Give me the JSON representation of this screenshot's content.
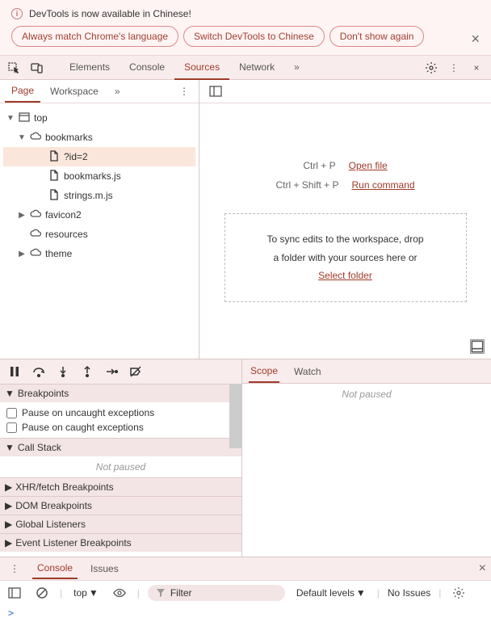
{
  "banner": {
    "title": "DevTools is now available in Chinese!",
    "buttons": [
      "Always match Chrome's language",
      "Switch DevTools to Chinese",
      "Don't show again"
    ]
  },
  "toolbar": {
    "tabs": [
      "Elements",
      "Console",
      "Sources",
      "Network"
    ],
    "active": "Sources"
  },
  "sidebar": {
    "tabs": [
      "Page",
      "Workspace"
    ],
    "active": "Page",
    "tree": {
      "top": "top",
      "bookmarks": "bookmarks",
      "files": [
        "?id=2",
        "bookmarks.js",
        "strings.m.js"
      ],
      "folders": [
        "favicon2",
        "resources",
        "theme"
      ]
    }
  },
  "editor": {
    "openFileKey": "Ctrl + P",
    "openFileLabel": "Open file",
    "runCmdKey": "Ctrl + Shift + P",
    "runCmdLabel": "Run command",
    "dropLine1": "To sync edits to the workspace, drop",
    "dropLine2": "a folder with your sources here or",
    "selectFolder": "Select folder"
  },
  "debug": {
    "sections": {
      "breakpoints": "Breakpoints",
      "pauseUncaught": "Pause on uncaught exceptions",
      "pauseCaught": "Pause on caught exceptions",
      "callStack": "Call Stack",
      "notPaused": "Not paused",
      "xhr": "XHR/fetch Breakpoints",
      "dom": "DOM Breakpoints",
      "global": "Global Listeners",
      "event": "Event Listener Breakpoints"
    },
    "scopeTabs": [
      "Scope",
      "Watch"
    ],
    "scopeNotPaused": "Not paused"
  },
  "drawer": {
    "tabs": [
      "Console",
      "Issues"
    ],
    "context": "top",
    "filterPlaceholder": "Filter",
    "levels": "Default levels",
    "issues": "No Issues",
    "prompt": ">"
  }
}
